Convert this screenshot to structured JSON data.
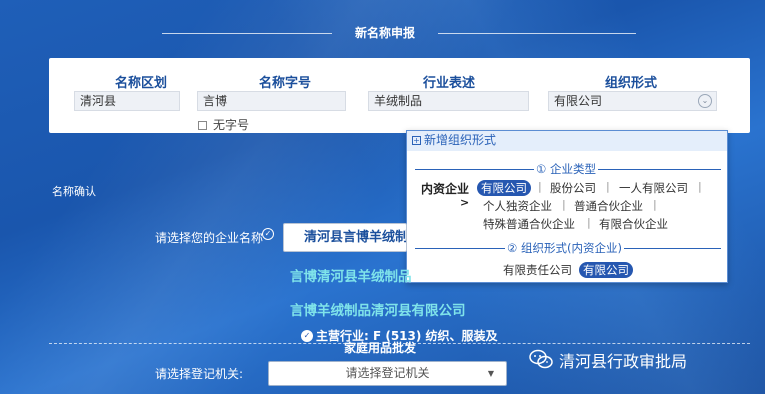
{
  "page": {
    "title": "新名称申报"
  },
  "form": {
    "labels": [
      "名称区划",
      "名称字号",
      "行业表述",
      "组织形式"
    ],
    "region_value": "清河县",
    "trade_name_value": "言博",
    "industry_value": "羊绒制品",
    "org_form_value": "有限公司",
    "no_trade_name_label": "无字号"
  },
  "popup": {
    "header": "新增组织形式",
    "section1_title": "① 企业类型",
    "category_label": "内资企业",
    "category_arrow": ">",
    "row1": [
      "有限公司",
      "股份公司",
      "一人有限公司"
    ],
    "row2": [
      "个人独资企业",
      "普通合伙企业"
    ],
    "row3": [
      "特殊普通合伙企业",
      "有限合伙企业"
    ],
    "section2_title": "② 组织形式(内资企业)",
    "row4": [
      "有限责任公司",
      "有限公司"
    ],
    "separator": "|"
  },
  "confirm": {
    "section_label": "名称确认",
    "choose_label": "请选择您的企业名称",
    "selected_name": "清河县言博羊绒制",
    "options": [
      "言博清河县羊绒制品",
      "言博羊绒制品清河县有限公司"
    ],
    "industry_text_1": "主营行业: F (513) 纺织、服装及",
    "industry_text_2": "家庭用品批发",
    "authority_label": "请选择登记机关:",
    "authority_placeholder": "请选择登记机关"
  },
  "watermark": {
    "text": "清河县行政审批局",
    "icon": "wechat-icon"
  },
  "colors": {
    "accent": "#2657b0",
    "label_blue": "#1b4f9c",
    "option_cyan": "#7fe3ea"
  }
}
